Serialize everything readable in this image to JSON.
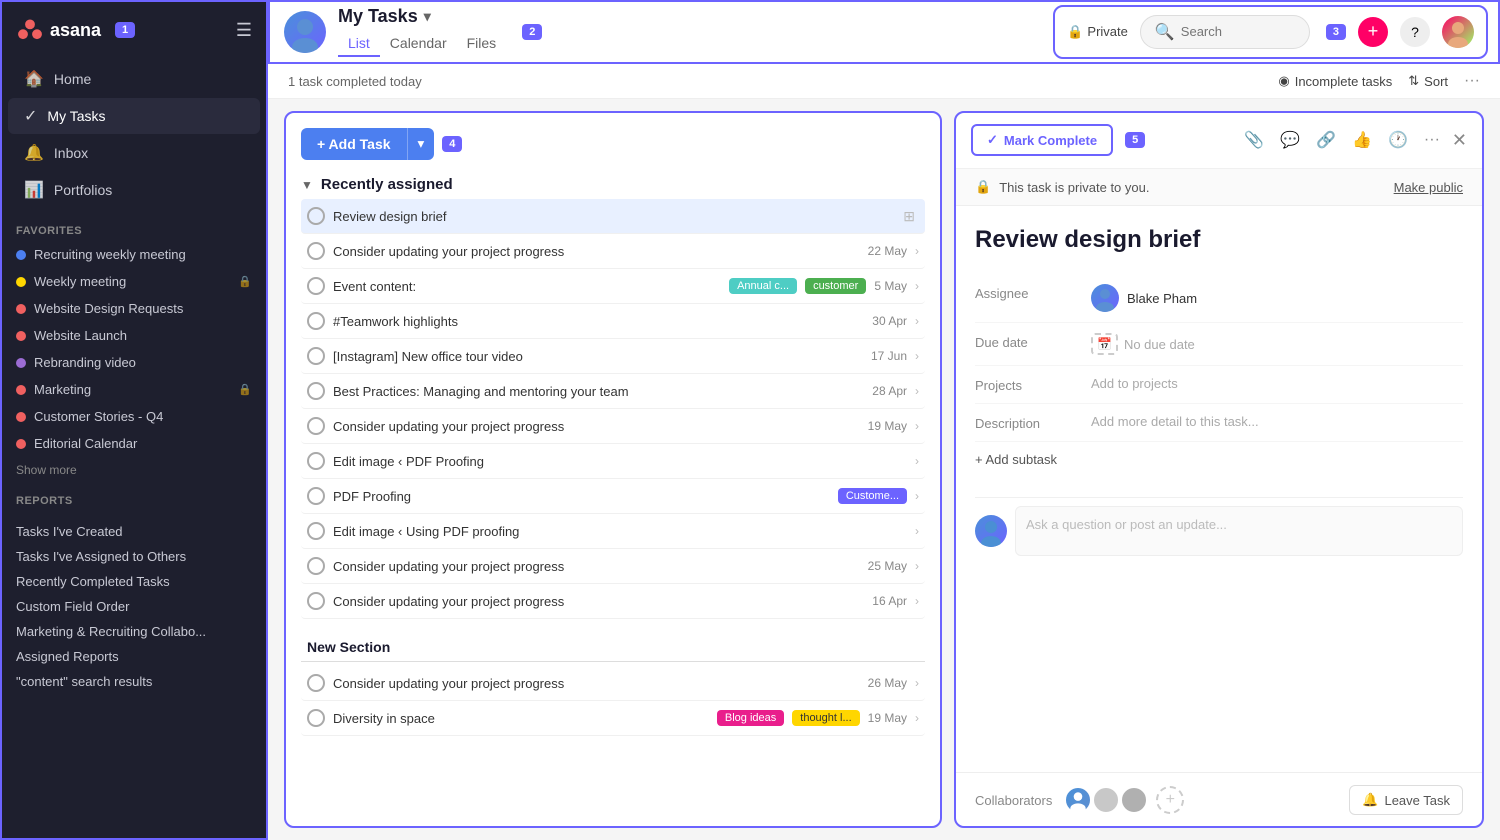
{
  "sidebar": {
    "logo_text": "asana",
    "badge1": "1",
    "nav": [
      {
        "icon": "🏠",
        "label": "Home"
      },
      {
        "icon": "✓",
        "label": "My Tasks",
        "active": true
      },
      {
        "icon": "🔔",
        "label": "Inbox"
      },
      {
        "icon": "📊",
        "label": "Portfolios"
      }
    ],
    "favorites_label": "Favorites",
    "favorites": [
      {
        "color": "#4c7ff0",
        "label": "Recruiting weekly meeting"
      },
      {
        "color": "#ffd600",
        "label": "Weekly meeting",
        "lock": true
      },
      {
        "color": "#f06060",
        "label": "Website Design Requests"
      },
      {
        "color": "#f06060",
        "label": "Website Launch"
      },
      {
        "color": "#9c6cd4",
        "label": "Rebranding video"
      },
      {
        "color": "#f06060",
        "label": "Marketing",
        "lock": true
      },
      {
        "color": "#f06060",
        "label": "Customer Stories - Q4"
      },
      {
        "color": "#f06060",
        "label": "Editorial Calendar"
      }
    ],
    "show_more": "Show more",
    "reports_label": "Reports",
    "reports": [
      {
        "label": "Tasks I've Created"
      },
      {
        "label": "Tasks I've Assigned to Others"
      },
      {
        "label": "Recently Completed Tasks"
      },
      {
        "label": "Custom Field Order"
      },
      {
        "label": "Marketing & Recruiting Collabo..."
      },
      {
        "label": "Assigned Reports"
      },
      {
        "label": "\"content\" search results"
      }
    ]
  },
  "header": {
    "title": "My Tasks",
    "tabs": [
      "List",
      "Calendar",
      "Files"
    ],
    "active_tab": "List",
    "badge2": "2",
    "subtitle": "1 task completed today",
    "private_label": "Private",
    "search_placeholder": "Search",
    "badge3": "3",
    "incomplete_tasks": "Incomplete tasks",
    "sort": "Sort"
  },
  "task_list": {
    "badge4": "4",
    "add_task_label": "+ Add Task",
    "section_recently": "Recently assigned",
    "tasks": [
      {
        "name": "Review design brief",
        "selected": true,
        "date": "",
        "tags": [],
        "has_grid": true
      },
      {
        "name": "Consider updating your project progress",
        "date": "22 May",
        "tags": []
      },
      {
        "name": "Event content:",
        "date": "5 May",
        "tags": [
          {
            "label": "Annual c...",
            "color": "teal"
          },
          {
            "label": "customer",
            "color": "green"
          }
        ]
      },
      {
        "name": "#Teamwork highlights",
        "date": "30 Apr",
        "tags": []
      },
      {
        "name": "[Instagram] New office tour video",
        "date": "17 Jun",
        "tags": []
      },
      {
        "name": "Best Practices: Managing and mentoring your team",
        "date": "28 Apr",
        "tags": []
      },
      {
        "name": "Consider updating your project progress",
        "date": "19 May",
        "tags": []
      },
      {
        "name": "Edit image  ‹ PDF Proofing",
        "date": "",
        "tags": []
      },
      {
        "name": "PDF Proofing",
        "date": "",
        "tags": [
          {
            "label": "Custome...",
            "color": "purple"
          }
        ]
      },
      {
        "name": "Edit image  ‹ Using PDF proofing",
        "date": "",
        "tags": []
      },
      {
        "name": "Consider updating your project progress",
        "date": "25 May",
        "tags": []
      },
      {
        "name": "Consider updating your project progress",
        "date": "16 Apr",
        "tags": []
      }
    ],
    "new_section_label": "New Section",
    "new_section_tasks": [
      {
        "name": "Consider updating your project progress",
        "date": "26 May",
        "tags": []
      },
      {
        "name": "Diversity in space",
        "date": "19 May",
        "tags": [
          {
            "label": "Blog ideas",
            "color": "pink"
          },
          {
            "label": "thought l...",
            "color": "yellow"
          }
        ]
      }
    ]
  },
  "detail": {
    "badge5": "5",
    "mark_complete": "Mark Complete",
    "private_note": "This task is private to you.",
    "make_public": "Make public",
    "title": "Review design brief",
    "assignee_label": "Assignee",
    "assignee_name": "Blake Pham",
    "due_date_label": "Due date",
    "due_date_value": "No due date",
    "projects_label": "Projects",
    "projects_value": "Add to projects",
    "description_label": "Description",
    "description_value": "Add more detail to this task...",
    "add_subtask": "+ Add subtask",
    "comment_placeholder": "Ask a question or post an update...",
    "collaborators_label": "Collaborators",
    "leave_task": "Leave Task"
  }
}
